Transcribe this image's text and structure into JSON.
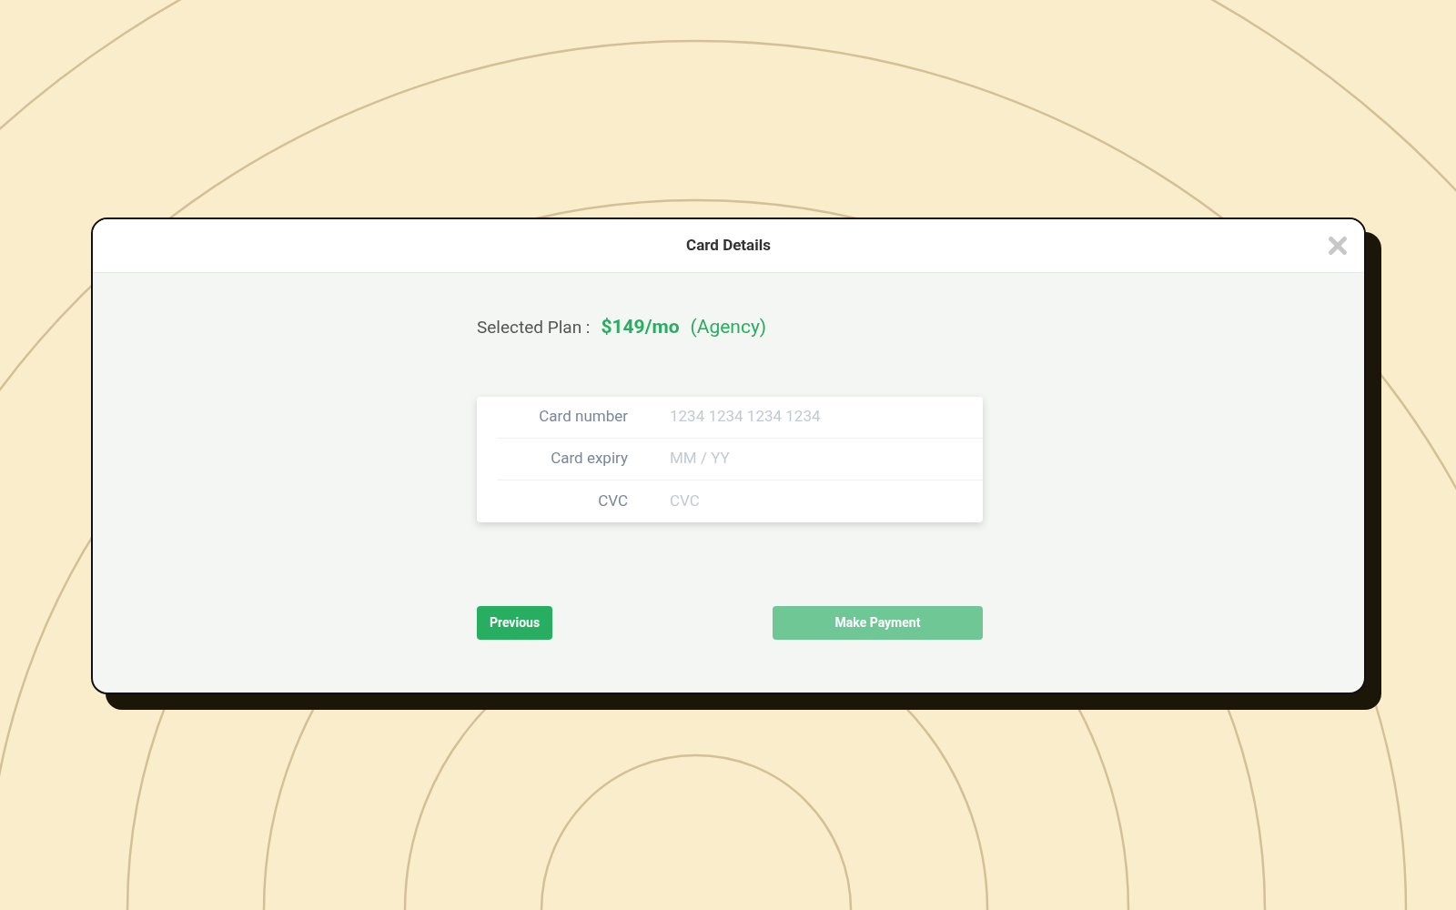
{
  "dialog": {
    "title": "Card Details"
  },
  "plan": {
    "label": "Selected Plan :",
    "price": "$149/mo",
    "name": "(Agency)"
  },
  "fields": [
    {
      "label": "Card number",
      "placeholder": "1234 1234 1234 1234"
    },
    {
      "label": "Card expiry",
      "placeholder": "MM / YY"
    },
    {
      "label": "CVC",
      "placeholder": "CVC"
    }
  ],
  "buttons": [
    {
      "label": "Previous",
      "disabled": false
    },
    {
      "label": "Make Payment",
      "disabled": true
    }
  ]
}
